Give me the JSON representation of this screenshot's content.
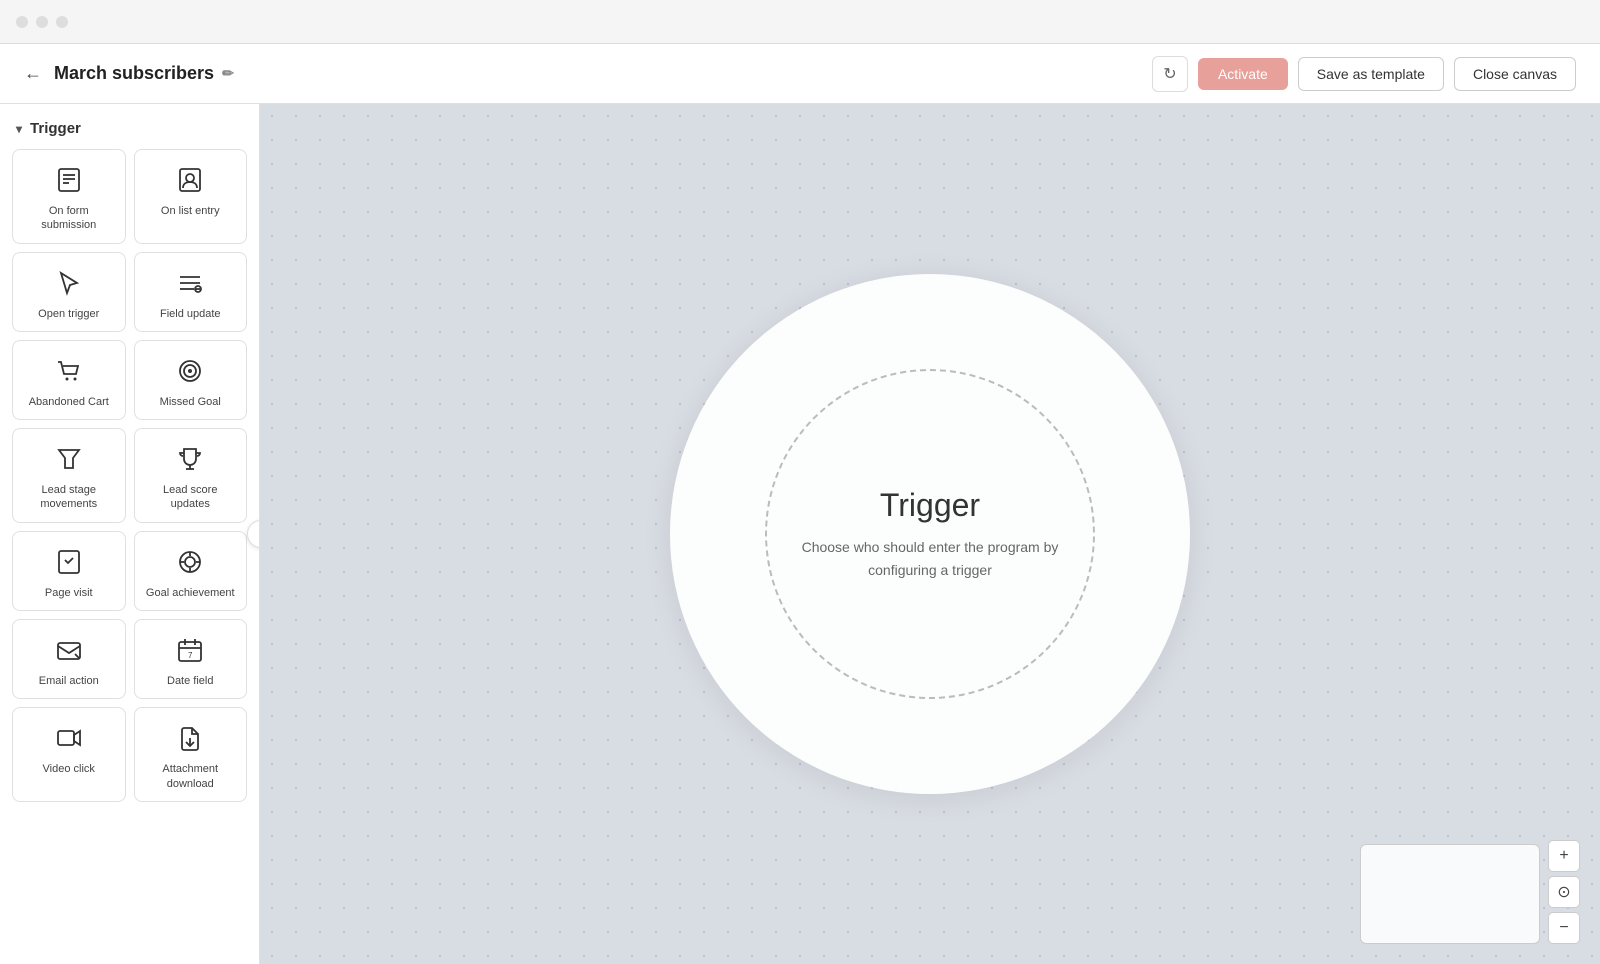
{
  "titlebar": {
    "traffic_lights": [
      "red",
      "yellow",
      "green"
    ]
  },
  "topbar": {
    "back_icon": "←",
    "title": "March subscribers",
    "edit_icon": "✏️",
    "refresh_icon": "↻",
    "activate_label": "Activate",
    "save_template_label": "Save as template",
    "close_canvas_label": "Close canvas"
  },
  "sidebar": {
    "section_label": "Trigger",
    "chevron_icon": "▾",
    "items": [
      {
        "id": "on-form-submission",
        "label": "On form submission",
        "icon": "form"
      },
      {
        "id": "on-list-entry",
        "label": "On list entry",
        "icon": "person"
      },
      {
        "id": "open-trigger",
        "label": "Open trigger",
        "icon": "cursor"
      },
      {
        "id": "field-update",
        "label": "Field update",
        "icon": "field"
      },
      {
        "id": "abandoned-cart",
        "label": "Abandoned Cart",
        "icon": "cart"
      },
      {
        "id": "missed-goal",
        "label": "Missed Goal",
        "icon": "target"
      },
      {
        "id": "lead-stage-movements",
        "label": "Lead stage movements",
        "icon": "funnel"
      },
      {
        "id": "lead-score-updates",
        "label": "Lead score updates",
        "icon": "trophy"
      },
      {
        "id": "page-visit",
        "label": "Page visit",
        "icon": "page"
      },
      {
        "id": "goal-achievement",
        "label": "Goal achievement",
        "icon": "goal"
      },
      {
        "id": "email-action",
        "label": "Email action",
        "icon": "email"
      },
      {
        "id": "date-field",
        "label": "Date field",
        "icon": "calendar"
      },
      {
        "id": "video-click",
        "label": "Video click",
        "icon": "video"
      },
      {
        "id": "attachment-download",
        "label": "Attachment download",
        "icon": "attachment"
      }
    ]
  },
  "canvas": {
    "trigger_title": "Trigger",
    "trigger_desc": "Choose who should enter the program by configuring a trigger"
  },
  "zoom": {
    "zoom_in": "+",
    "zoom_reset": "⊙",
    "zoom_out": "−"
  }
}
